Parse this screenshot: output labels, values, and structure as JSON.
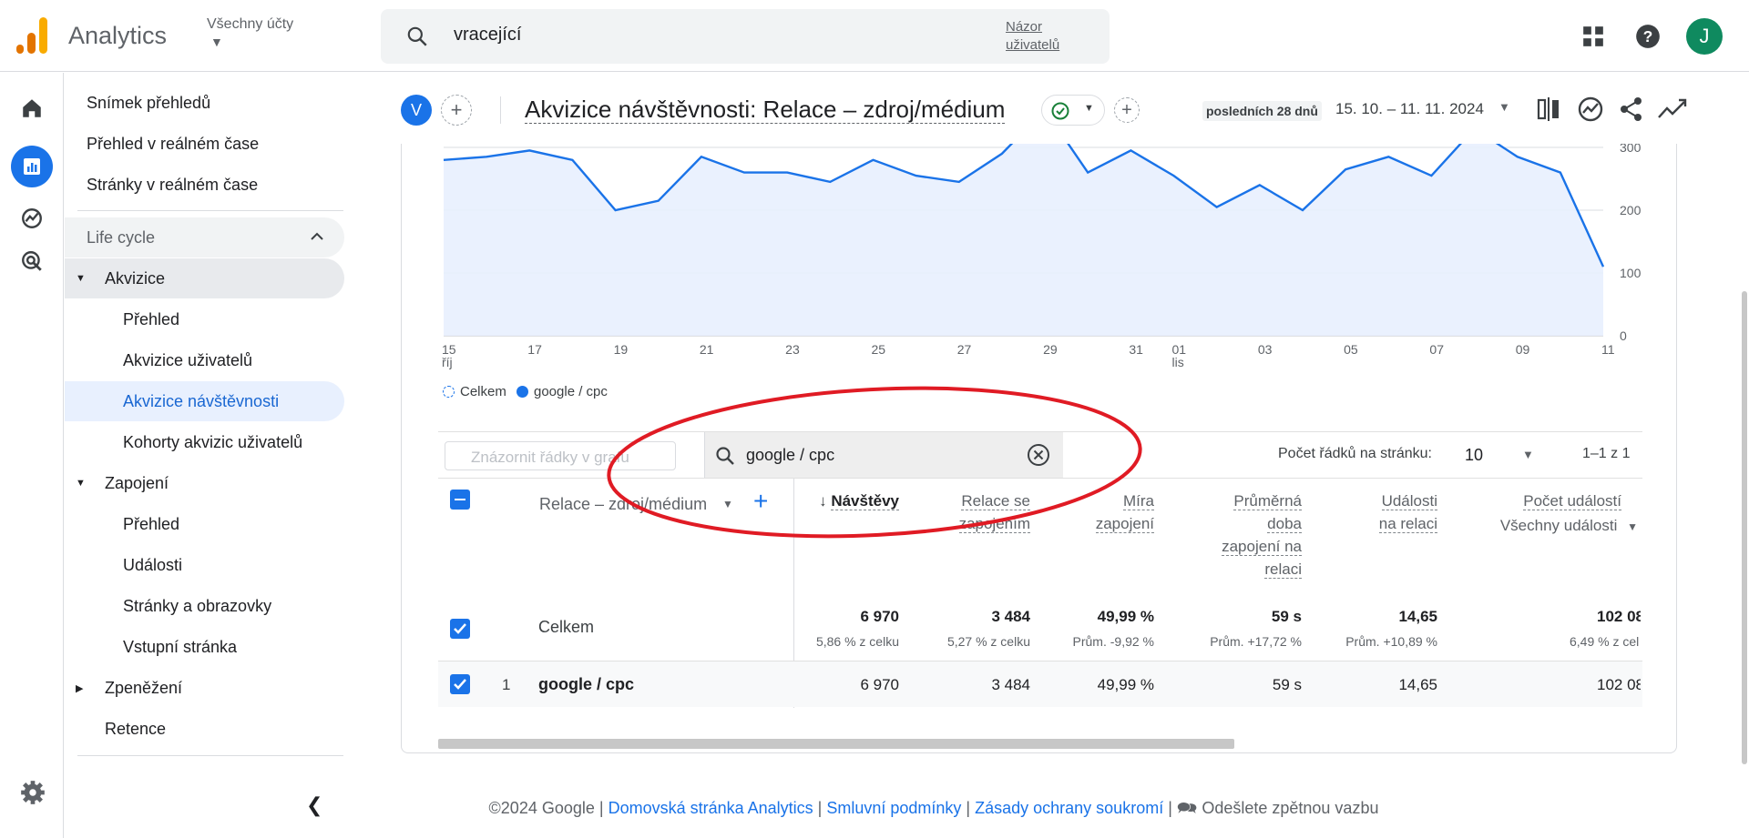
{
  "app": {
    "name": "Analytics",
    "account_label": "Všechny účty",
    "search_query": "vracející",
    "search_view_link": "Názor uživatelů",
    "avatar_letter": "J",
    "brand_color": "#f9ab00",
    "accent_color": "#1a73e8"
  },
  "rail": {
    "items": [
      "home-icon",
      "reports-icon",
      "explore-icon",
      "advertising-icon"
    ]
  },
  "nav": {
    "items": [
      {
        "label": "Snímek přehledů",
        "level": 0
      },
      {
        "label": "Přehled v reálném čase",
        "level": 0
      },
      {
        "label": "Stránky v reálném čase",
        "level": 0
      }
    ],
    "section_label": "Life cycle",
    "groups": [
      {
        "label": "Akvizice",
        "expanded": true,
        "children": [
          "Přehled",
          "Akvizice uživatelů",
          "Akvizice návštěvnosti",
          "Kohorty akvizic uživatelů"
        ]
      },
      {
        "label": "Zapojení",
        "expanded": true,
        "children": [
          "Přehled",
          "Události",
          "Stránky a obrazovky",
          "Vstupní stránka"
        ]
      },
      {
        "label": "Zpeněžení",
        "expanded": false,
        "children": []
      },
      {
        "label": "Retence",
        "expanded": false,
        "children": []
      }
    ],
    "active_item": "Akvizice návštěvnosti"
  },
  "header": {
    "comparison_chip": "V",
    "title": "Akvizice návštěvnosti: Relace – zdroj/médium",
    "date_label": "posledních 28 dnů",
    "date_range": "15. 10. – 11. 11. 2024"
  },
  "chart_data": {
    "type": "area",
    "x": [
      "15",
      "16",
      "17",
      "18",
      "19",
      "20",
      "21",
      "22",
      "23",
      "24",
      "25",
      "26",
      "27",
      "28",
      "29",
      "30",
      "31",
      "01",
      "02",
      "03",
      "04",
      "05",
      "06",
      "07",
      "08",
      "09",
      "10",
      "11"
    ],
    "x_tick_labels": [
      {
        "label": "15",
        "sub": "říj"
      },
      {
        "label": "17"
      },
      {
        "label": "19"
      },
      {
        "label": "21"
      },
      {
        "label": "23"
      },
      {
        "label": "25"
      },
      {
        "label": "27"
      },
      {
        "label": "29"
      },
      {
        "label": "31"
      },
      {
        "label": "01",
        "sub": "lis"
      },
      {
        "label": "03"
      },
      {
        "label": "05"
      },
      {
        "label": "07"
      },
      {
        "label": "09"
      },
      {
        "label": "11"
      }
    ],
    "y_ticks": [
      0,
      100,
      200,
      300
    ],
    "ylim": [
      0,
      300
    ],
    "series": [
      {
        "name": "Celkem",
        "values": [
          280,
          285,
          295,
          280,
          200,
          215,
          285,
          260,
          260,
          245,
          280,
          255,
          245,
          290,
          360,
          260,
          295,
          255,
          205,
          240,
          200,
          265,
          285,
          255,
          330,
          285,
          260,
          110
        ]
      },
      {
        "name": "google / cpc",
        "values": [
          280,
          285,
          295,
          280,
          200,
          215,
          285,
          260,
          260,
          245,
          280,
          255,
          245,
          290,
          360,
          260,
          295,
          255,
          205,
          240,
          200,
          265,
          285,
          255,
          330,
          285,
          260,
          110
        ]
      }
    ],
    "series_colors": [
      "#1a73e8",
      "#1a73e8"
    ]
  },
  "table": {
    "plot_rows_placeholder": "Znázornit řádky v grafu",
    "filter_value": "google / cpc",
    "rows_per_page_label": "Počet řádků na stránku:",
    "rows_per_page": "10",
    "pagination": "1–1 z 1",
    "dimension_header": "Relace – zdroj/médium",
    "columns": [
      {
        "label": "Návštěvy",
        "sorted": true
      },
      {
        "label": "Relace se zapojením"
      },
      {
        "label": "Míra zapojení"
      },
      {
        "label": "Průměrná doba zapojení na relaci"
      },
      {
        "label": "Události na relaci"
      },
      {
        "label": "Počet událostí",
        "sub": "Všechny události"
      }
    ],
    "totals": {
      "label": "Celkem",
      "values": [
        "6 970",
        "3 484",
        "49,99 %",
        "59 s",
        "14,65",
        "102 08"
      ],
      "subs": [
        "5,86 % z celku",
        "5,27 % z celku",
        "Prům. -9,92 %",
        "Prům. +17,72 %",
        "Prům. +10,89 %",
        "6,49 % z cel"
      ]
    },
    "rows": [
      {
        "index": "1",
        "dimension": "google / cpc",
        "values": [
          "6 970",
          "3 484",
          "49,99 %",
          "59 s",
          "14,65",
          "102 08"
        ]
      }
    ]
  },
  "footer": {
    "copyright": "©2024 Google |",
    "links": [
      "Domovská stránka Analytics",
      "Smluvní podmínky",
      "Zásady ochrany soukromí"
    ],
    "feedback": "Odešlete zpětnou vazbu"
  }
}
